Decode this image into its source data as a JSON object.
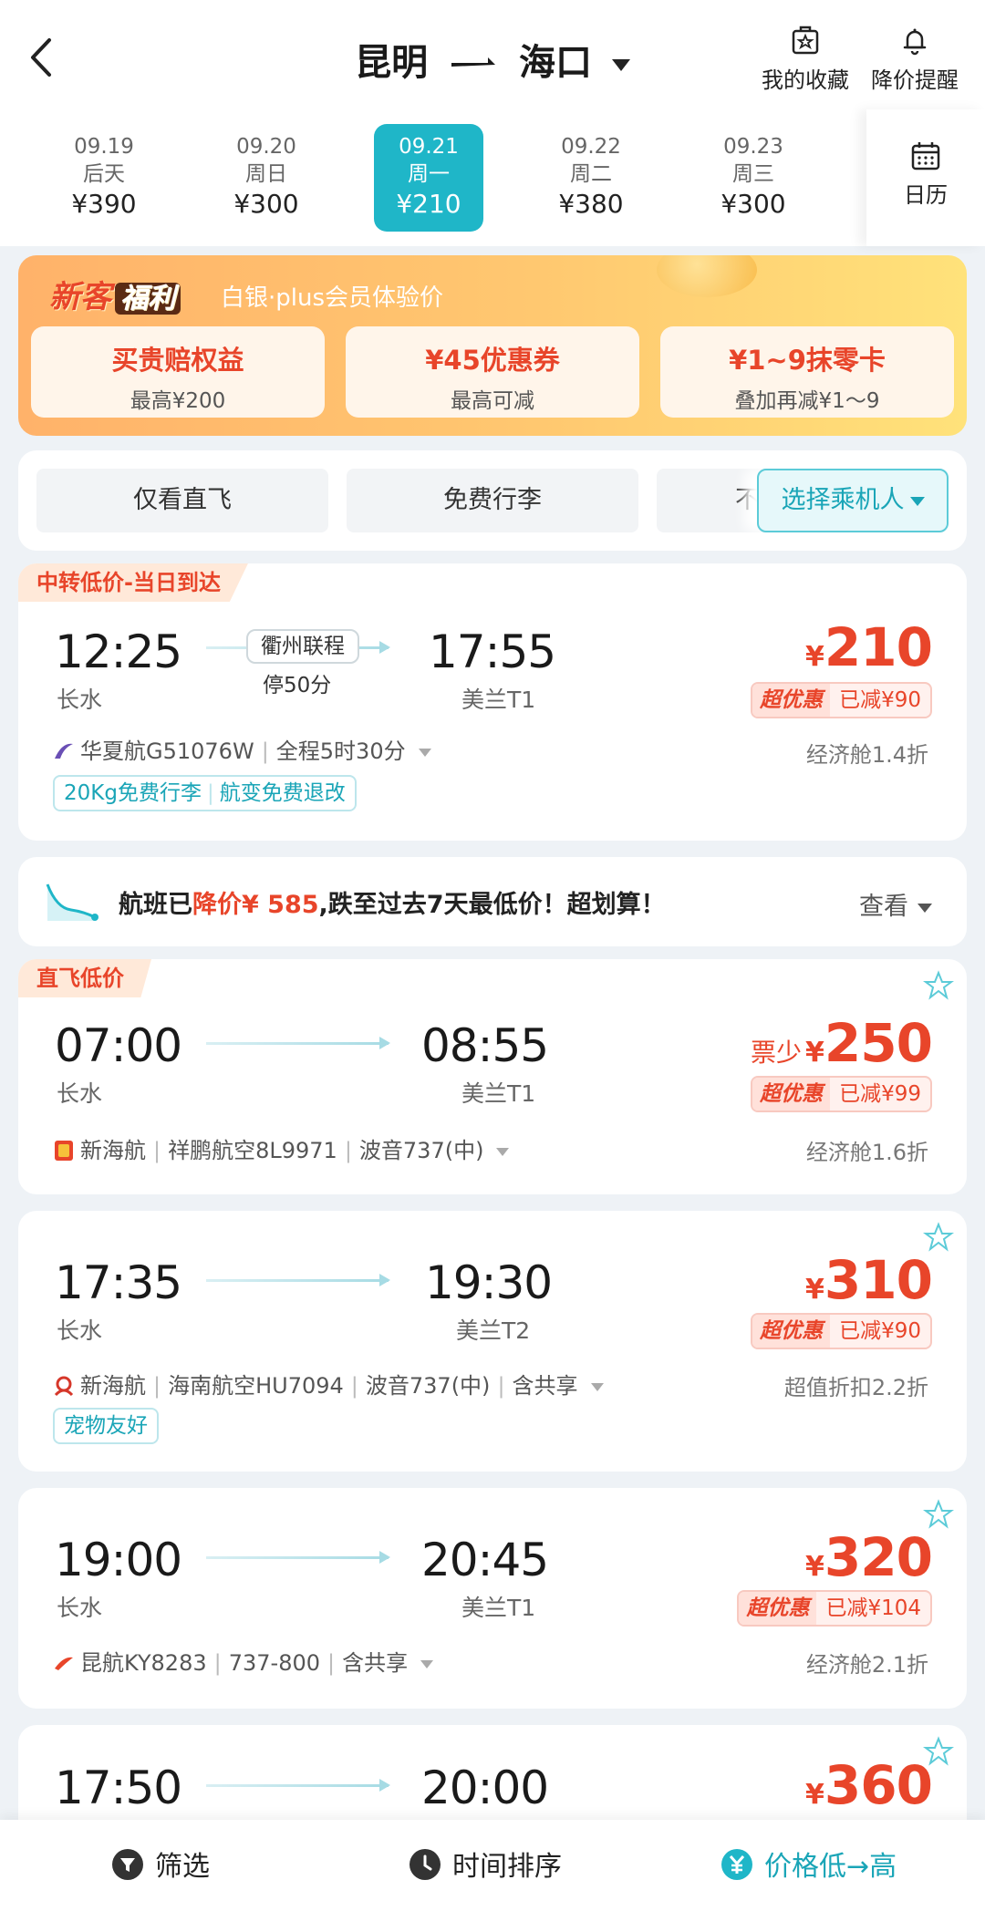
{
  "header": {
    "origin": "昆明",
    "destination": "海口",
    "favorites_label": "我的收藏",
    "price_alert_label": "降价提醒"
  },
  "dates": [
    {
      "date": "09.19",
      "weekday": "后天",
      "price": "¥390",
      "selected": false
    },
    {
      "date": "09.20",
      "weekday": "周日",
      "price": "¥300",
      "selected": false
    },
    {
      "date": "09.21",
      "weekday": "周一",
      "price": "¥210",
      "selected": true
    },
    {
      "date": "09.22",
      "weekday": "周二",
      "price": "¥380",
      "selected": false
    },
    {
      "date": "09.23",
      "weekday": "周三",
      "price": "¥300",
      "selected": false
    }
  ],
  "calendar_label": "日历",
  "promo": {
    "logo_a": "新客",
    "logo_b": "福利",
    "subtitle": "白银·plus会员体验价",
    "cards": [
      {
        "title": "买贵赔权益",
        "sub": "最高¥200"
      },
      {
        "title": "¥45优惠券",
        "sub": "最高可减"
      },
      {
        "title": "¥1~9抹零卡",
        "sub": "叠加再减¥1～9"
      }
    ]
  },
  "filters": {
    "chips": [
      "仅看直飞",
      "免费行李",
      "不"
    ],
    "passenger_label": "选择乘机人"
  },
  "transfer_flight": {
    "tag": "中转低价-当日到达",
    "dep_time": "12:25",
    "dep_airport": "长水",
    "arr_time": "17:55",
    "arr_airport": "美兰T1",
    "transfer_city": "衢州联程",
    "stop": "停50分",
    "price_symbol": "¥",
    "price": "210",
    "deal_a": "超优惠",
    "deal_b": "已减¥90",
    "airline": "华夏航G51076W",
    "duration": "全程5时30分",
    "cabin": "经济舱1.4折",
    "perks": [
      "20Kg免费行李",
      "航变免费退改"
    ]
  },
  "notice": {
    "prefix": "航班已",
    "highlight": "降价¥ 585",
    "suffix": ",跌至过去7天最低价！超划算！",
    "action": "查看"
  },
  "direct_tag": "直飞低价",
  "flights": [
    {
      "dep_time": "07:00",
      "dep_airport": "长水",
      "arr_time": "08:55",
      "arr_airport": "美兰T1",
      "few": "票少",
      "price_symbol": "¥",
      "price": "250",
      "deal_a": "超优惠",
      "deal_b": "已减¥99",
      "info": [
        "新海航",
        "祥鹏航空8L9971",
        "波音737(中)"
      ],
      "cabin": "经济舱1.6折",
      "perks": []
    },
    {
      "dep_time": "17:35",
      "dep_airport": "长水",
      "arr_time": "19:30",
      "arr_airport": "美兰T2",
      "few": "",
      "price_symbol": "¥",
      "price": "310",
      "deal_a": "超优惠",
      "deal_b": "已减¥90",
      "info": [
        "新海航",
        "海南航空HU7094",
        "波音737(中)",
        "含共享"
      ],
      "cabin": "超值折扣2.2折",
      "perks": [
        "宠物友好"
      ]
    },
    {
      "dep_time": "19:00",
      "dep_airport": "长水",
      "arr_time": "20:45",
      "arr_airport": "美兰T1",
      "few": "",
      "price_symbol": "¥",
      "price": "320",
      "deal_a": "超优惠",
      "deal_b": "已减¥104",
      "info": [
        "昆航KY8283",
        "737-800",
        "含共享"
      ],
      "cabin": "经济舱2.1折",
      "perks": []
    },
    {
      "dep_time": "17:50",
      "dep_airport": "",
      "arr_time": "20:00",
      "arr_airport": "",
      "few": "",
      "price_symbol": "¥",
      "price": "360",
      "deal_a": "",
      "deal_b": "",
      "info": [],
      "cabin": "",
      "perks": []
    }
  ],
  "bottom_bar": {
    "filter": "筛选",
    "time_sort": "时间排序",
    "price_sort": "价格低→高"
  },
  "colors": {
    "accent": "#1fb6c8",
    "price": "#e8452a"
  }
}
